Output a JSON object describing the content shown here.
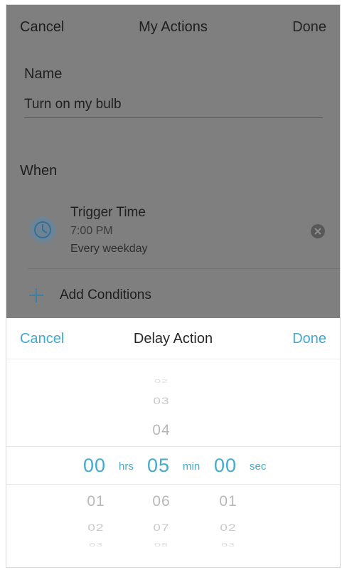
{
  "nav": {
    "cancel": "Cancel",
    "title": "My Actions",
    "done": "Done"
  },
  "name": {
    "label": "Name",
    "value": "Turn on my bulb"
  },
  "when": {
    "label": "When",
    "trigger": {
      "title": "Trigger Time",
      "time": "7:00 PM",
      "repeat": "Every weekday",
      "icon": "clock-icon"
    }
  },
  "add_conditions": {
    "label": "Add Conditions",
    "icon": "plus-icon"
  },
  "sheet": {
    "cancel": "Cancel",
    "title": "Delay Action",
    "done": "Done",
    "picker": {
      "hours": {
        "selected": "00",
        "unit": "hrs",
        "below": [
          "01",
          "02"
        ]
      },
      "minutes": {
        "selected": "05",
        "unit": "min",
        "above": [
          "03",
          "04"
        ],
        "below": [
          "06",
          "07"
        ]
      },
      "seconds": {
        "selected": "00",
        "unit": "sec",
        "below": [
          "01",
          "02"
        ]
      }
    }
  },
  "colors": {
    "accent": "#43a9cf",
    "dim_overlay": "#7f7f80"
  }
}
